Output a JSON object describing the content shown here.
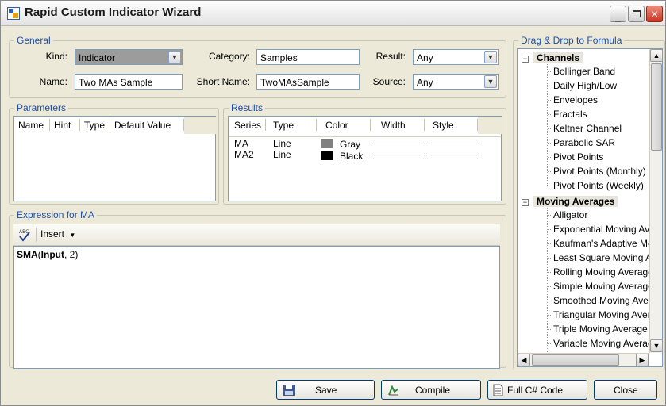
{
  "window": {
    "title": "Rapid Custom Indicator Wizard"
  },
  "general": {
    "title": "General",
    "kind_label": "Kind:",
    "kind_value": "Indicator",
    "name_label": "Name:",
    "name_value": "Two MAs Sample",
    "category_label": "Category:",
    "category_value": "Samples",
    "short_name_label": "Short Name:",
    "short_name_value": "TwoMAsSample",
    "result_label": "Result:",
    "result_value": "Any",
    "source_label": "Source:",
    "source_value": "Any"
  },
  "parameters": {
    "title": "Parameters",
    "columns": [
      "Name",
      "Hint",
      "Type",
      "Default Value"
    ]
  },
  "results": {
    "title": "Results",
    "columns": [
      "Series",
      "Type",
      "Color",
      "Width",
      "Style"
    ],
    "rows": [
      {
        "series": "MA",
        "type": "Line",
        "color_name": "Gray",
        "color": "#808080"
      },
      {
        "series": "MA2",
        "type": "Line",
        "color_name": "Black",
        "color": "#000000"
      }
    ]
  },
  "expression": {
    "title": "Expression for MA",
    "insert_label": "Insert",
    "func": "SMA",
    "arg_open": "(",
    "arg_name": "Input",
    "arg_rest": ", 2)"
  },
  "tree": {
    "title": "Drag & Drop to Formula",
    "categories": [
      {
        "name": "Channels",
        "items": [
          "Bollinger Band",
          "Daily High/Low",
          "Envelopes",
          "Fractals",
          "Keltner Channel",
          "Parabolic SAR",
          "Pivot Points",
          "Pivot Points (Monthly)",
          "Pivot Points (Weekly)"
        ]
      },
      {
        "name": "Moving Averages",
        "items": [
          "Alligator",
          "Exponential Moving Av",
          "Kaufman's Adaptive Mo",
          "Least Square Moving A",
          "Rolling Moving Average",
          "Simple Moving Average",
          "Smoothed Moving Aver",
          "Triangular Moving Aver",
          "Triple Moving Average",
          "Variable Moving Averag"
        ]
      }
    ]
  },
  "buttons": {
    "save": "Save",
    "compile": "Compile",
    "full_code": "Full C# Code",
    "close": "Close"
  },
  "colors": {
    "accent": "#1e4ea8",
    "window_bg": "#ece9d8"
  }
}
